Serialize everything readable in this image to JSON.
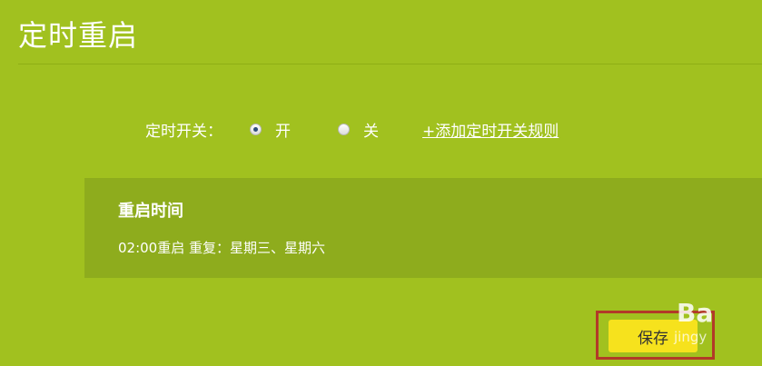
{
  "header": {
    "title": "定时重启"
  },
  "schedule_switch": {
    "label": "定时开关：",
    "options": [
      {
        "label": "开",
        "selected": true
      },
      {
        "label": "关",
        "selected": false
      }
    ],
    "add_rule_link": "+添加定时开关规则"
  },
  "rule": {
    "title": "重启时间",
    "detail": "02:00重启  重复：星期三、星期六"
  },
  "footer": {
    "save_label": "保存"
  },
  "watermark": {
    "mark": "Ba",
    "text": "jingy"
  },
  "colors": {
    "background": "#a1c11f",
    "rule_box": "#8eac1d",
    "save_button": "#f6e21d",
    "highlight_border": "#b23a28"
  }
}
